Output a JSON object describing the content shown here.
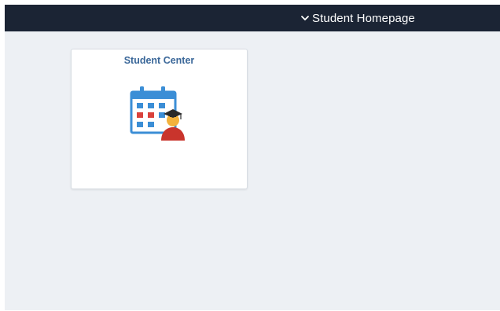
{
  "header": {
    "homepage_selector": {
      "label": "Student Homepage",
      "icon": "chevron-down-icon"
    }
  },
  "tiles": [
    {
      "title": "Student Center",
      "icon": "calendar-graduate-icon"
    }
  ],
  "colors": {
    "header_bg": "#1b2434",
    "page_bg": "#edf0f4",
    "tile_title": "#3a6799",
    "calendar_blue": "#3b8ed6",
    "calendar_red": "#d9423c",
    "graduate_skin": "#f3b23c",
    "graduate_body": "#c9342c"
  }
}
